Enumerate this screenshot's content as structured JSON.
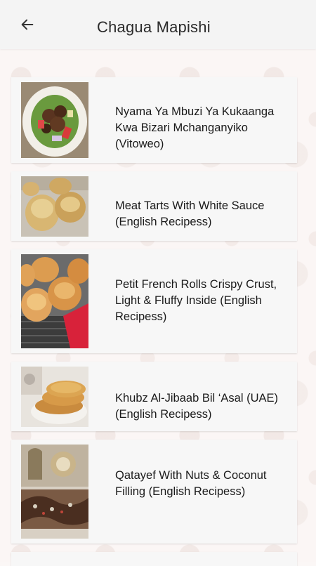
{
  "header": {
    "title": "Chagua Mapishi",
    "back_icon": "arrow-left-icon"
  },
  "colors": {
    "app_bar": "#f4f4f4",
    "card": "#f7f7f7",
    "text": "#1a1a1a"
  },
  "recipes": [
    {
      "title": "Nyama Ya Mbuzi Ya Kukaanga Kwa Bizari Mchanganyiko (Vitoweo)"
    },
    {
      "title": "Meat Tarts With White Sauce (English Recipess)"
    },
    {
      "title": "Petit French Rolls Crispy Crust, Light & Fluffy Inside (English Recipess)"
    },
    {
      "title": "Khubz Al-Jibaab Bil ‘Asal (UAE) (English Recipess)"
    },
    {
      "title": "Qatayef With Nuts & Coconut Filling (English Recipess)"
    }
  ]
}
